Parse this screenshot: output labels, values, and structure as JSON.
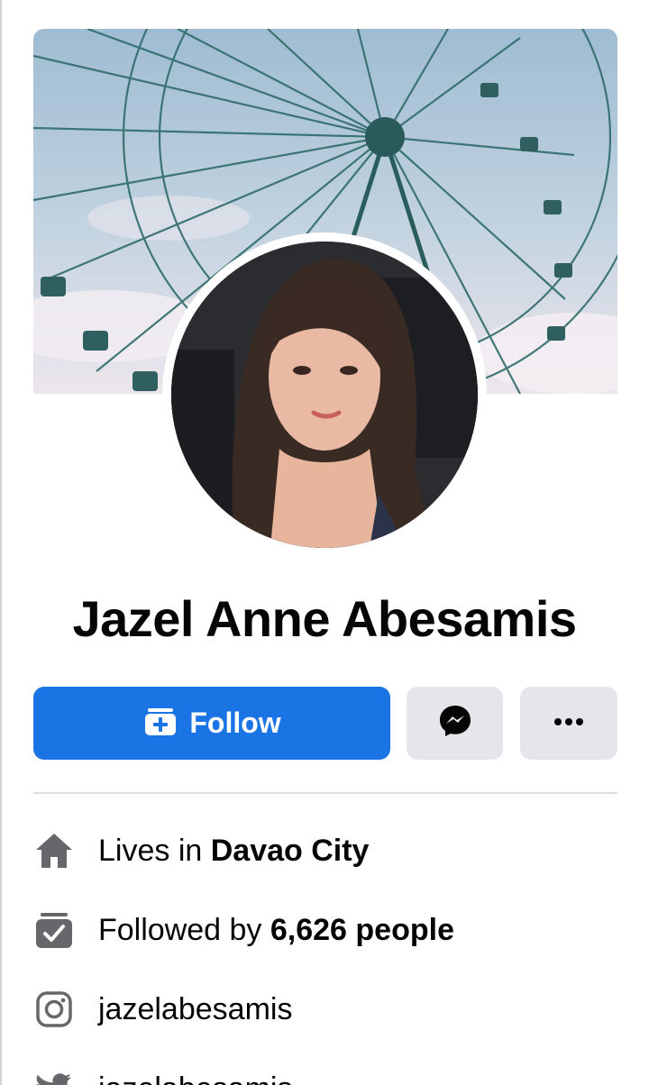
{
  "profile": {
    "name": "Jazel Anne Abesamis"
  },
  "actions": {
    "follow_label": "Follow",
    "message_icon": "messenger-icon",
    "more_icon": "more-dots-icon"
  },
  "details": [
    {
      "icon": "home-icon",
      "prefix": "Lives in ",
      "value": "Davao City"
    },
    {
      "icon": "followers-icon",
      "prefix": "Followed by ",
      "value": "6,626 people"
    },
    {
      "icon": "instagram-icon",
      "prefix": "",
      "value": "jazelabesamis"
    },
    {
      "icon": "twitter-icon",
      "prefix": "",
      "value": "jazelabesamis"
    }
  ],
  "colors": {
    "accent": "#1b74e4",
    "secondary_button": "#e4e6eb",
    "icon_gray": "#65676b"
  }
}
